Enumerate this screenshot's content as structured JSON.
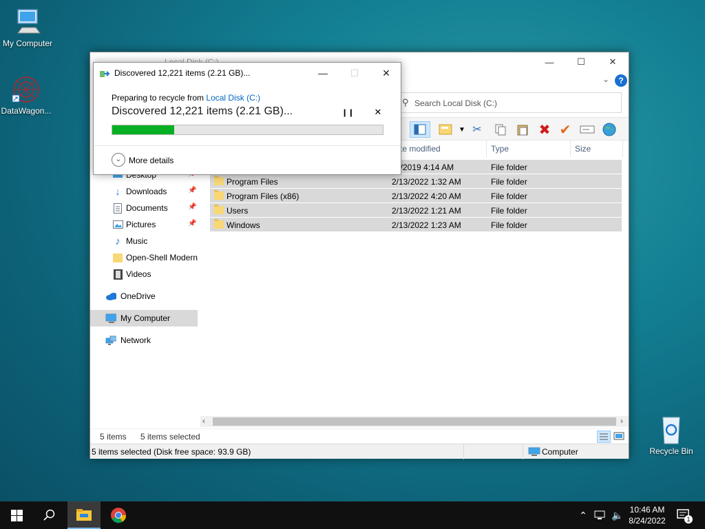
{
  "desktop": {
    "icons": [
      {
        "label": "My Computer"
      },
      {
        "label": "DataWagon..."
      },
      {
        "label": "Recycle Bin"
      }
    ]
  },
  "explorer": {
    "title": "Local Disk (C:)",
    "search_placeholder": "Search Local Disk (C:)",
    "columns": {
      "date": "te modified",
      "type": "Type",
      "size": "Size"
    },
    "files": [
      {
        "name": "",
        "date": "7/2019 4:14 AM",
        "type": "File folder"
      },
      {
        "name": "Program Files",
        "date": "2/13/2022 1:32 AM",
        "type": "File folder"
      },
      {
        "name": "Program Files (x86)",
        "date": "2/13/2022 4:20 AM",
        "type": "File folder"
      },
      {
        "name": "Users",
        "date": "2/13/2022 1:21 AM",
        "type": "File folder"
      },
      {
        "name": "Windows",
        "date": "2/13/2022 1:23 AM",
        "type": "File folder"
      }
    ],
    "nav": {
      "desktop": "Desktop",
      "downloads": "Downloads",
      "documents": "Documents",
      "pictures": "Pictures",
      "music": "Music",
      "openshell": "Open-Shell Modern",
      "videos": "Videos",
      "onedrive": "OneDrive",
      "mycomputer": "My Computer",
      "network": "Network"
    },
    "status": {
      "items": "5 items",
      "selected": "5 items selected",
      "detail": "5 items selected (Disk free space: 93.9 GB)",
      "location": "Computer"
    }
  },
  "dialog": {
    "title": "Discovered 12,221 items (2.21 GB)...",
    "preparing": "Preparing to recycle from",
    "source": "Local Disk (C:)",
    "headline": "Discovered 12,221 items (2.21 GB)...",
    "progress": 0.23,
    "more_details": "More details"
  },
  "taskbar": {
    "time": "10:46 AM",
    "date": "8/24/2022",
    "notifications": "1"
  },
  "colors": {
    "accent": "#0067c0",
    "progress": "#06b025",
    "close_red": "#e81123",
    "folder": "#f8d775"
  }
}
